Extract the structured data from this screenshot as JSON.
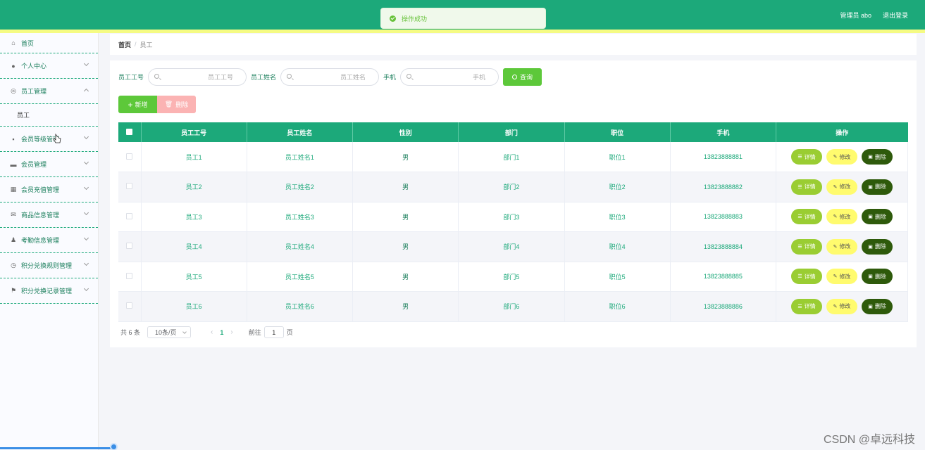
{
  "topbar": {
    "admin_label": "管理员 abo",
    "logout_label": "退出登录"
  },
  "toast": {
    "message": "操作成功"
  },
  "sidebar": {
    "items": [
      {
        "label": "首页",
        "icon": "home-icon"
      },
      {
        "label": "个人中心",
        "icon": "user-icon"
      },
      {
        "label": "员工管理",
        "icon": "staff-icon"
      },
      {
        "label": "会员等级管理",
        "icon": "chart-icon"
      },
      {
        "label": "会员管理",
        "icon": "message-icon"
      },
      {
        "label": "会员充值管理",
        "icon": "grid-icon"
      },
      {
        "label": "商品信息管理",
        "icon": "mail-icon"
      },
      {
        "label": "考勤信息管理",
        "icon": "person-icon"
      },
      {
        "label": "积分兑换规则管理",
        "icon": "clock-icon"
      },
      {
        "label": "积分兑换记录管理",
        "icon": "flag-icon"
      }
    ],
    "submenu_staff": "员工"
  },
  "breadcrumb": {
    "home": "首页",
    "separator": "/",
    "current": "员工"
  },
  "search": {
    "fields": [
      {
        "label": "员工工号",
        "placeholder": "员工工号"
      },
      {
        "label": "员工姓名",
        "placeholder": "员工姓名"
      },
      {
        "label": "手机",
        "placeholder": "手机"
      }
    ],
    "query_label": "查询"
  },
  "actions": {
    "add_label": "新增",
    "delete_label": "删除"
  },
  "table": {
    "headers": [
      "员工工号",
      "员工姓名",
      "性别",
      "部门",
      "职位",
      "手机",
      "操作"
    ],
    "rows": [
      [
        "员工1",
        "员工姓名1",
        "男",
        "部门1",
        "职位1",
        "13823888881"
      ],
      [
        "员工2",
        "员工姓名2",
        "男",
        "部门2",
        "职位2",
        "13823888882"
      ],
      [
        "员工3",
        "员工姓名3",
        "男",
        "部门3",
        "职位3",
        "13823888883"
      ],
      [
        "员工4",
        "员工姓名4",
        "男",
        "部门4",
        "职位4",
        "13823888884"
      ],
      [
        "员工5",
        "员工姓名5",
        "男",
        "部门5",
        "职位5",
        "13823888885"
      ],
      [
        "员工6",
        "员工姓名6",
        "男",
        "部门6",
        "职位6",
        "13823888886"
      ]
    ],
    "row_actions": {
      "detail": "详情",
      "edit": "修改",
      "delete": "删除"
    }
  },
  "pagination": {
    "total": "共 6 条",
    "page_size": "10条/页",
    "current_page": "1",
    "goto_label": "前往",
    "goto_value": "1",
    "page_suffix": "页"
  },
  "watermark": "CSDN @卓远科技",
  "colors": {
    "primary": "#1ca97a",
    "accent_strip": "#f5fb83",
    "success": "#5dc83a",
    "danger_light": "#fbb3b3",
    "detail_btn": "#9acd32",
    "edit_btn": "#fffb6e",
    "delete_btn": "#2e5a0b"
  }
}
